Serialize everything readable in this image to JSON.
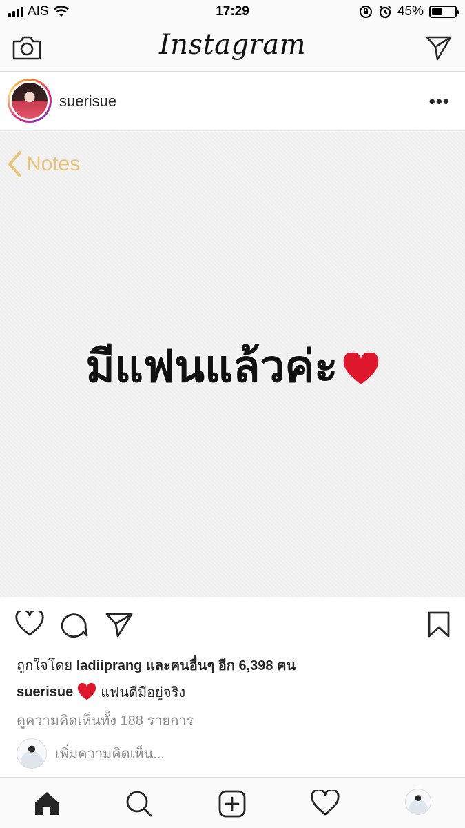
{
  "status_bar": {
    "carrier": "AIS",
    "time": "17:29",
    "battery_percent": "45%",
    "battery_level": 0.45
  },
  "header": {
    "logo": "Instagram",
    "icons": [
      "camera-icon",
      "direct-message-icon"
    ]
  },
  "post": {
    "username": "suerisue",
    "image": {
      "back_label": "Notes",
      "text": "มีแฟนแล้วค่ะ"
    },
    "likes_prefix": "ถูกใจโดย",
    "likes_user": "ladiiprang",
    "likes_suffix": "และคนอื่นๆ อีก 6,398 คน",
    "caption_user": "suerisue",
    "caption_text": "แฟนดีมีอยู่จริง",
    "view_comments": "ดูความคิดเห็นทั้ง 188 รายการ",
    "add_comment_placeholder": "เพิ่มความคิดเห็น..."
  },
  "tab_bar": {
    "items": [
      "home-icon",
      "search-icon",
      "add-post-icon",
      "activity-heart-icon",
      "profile-avatar"
    ]
  },
  "colors": {
    "notes_accent": "#e8c47a",
    "heart_red": "#e0182d",
    "muted_text": "#8e8e8e"
  }
}
